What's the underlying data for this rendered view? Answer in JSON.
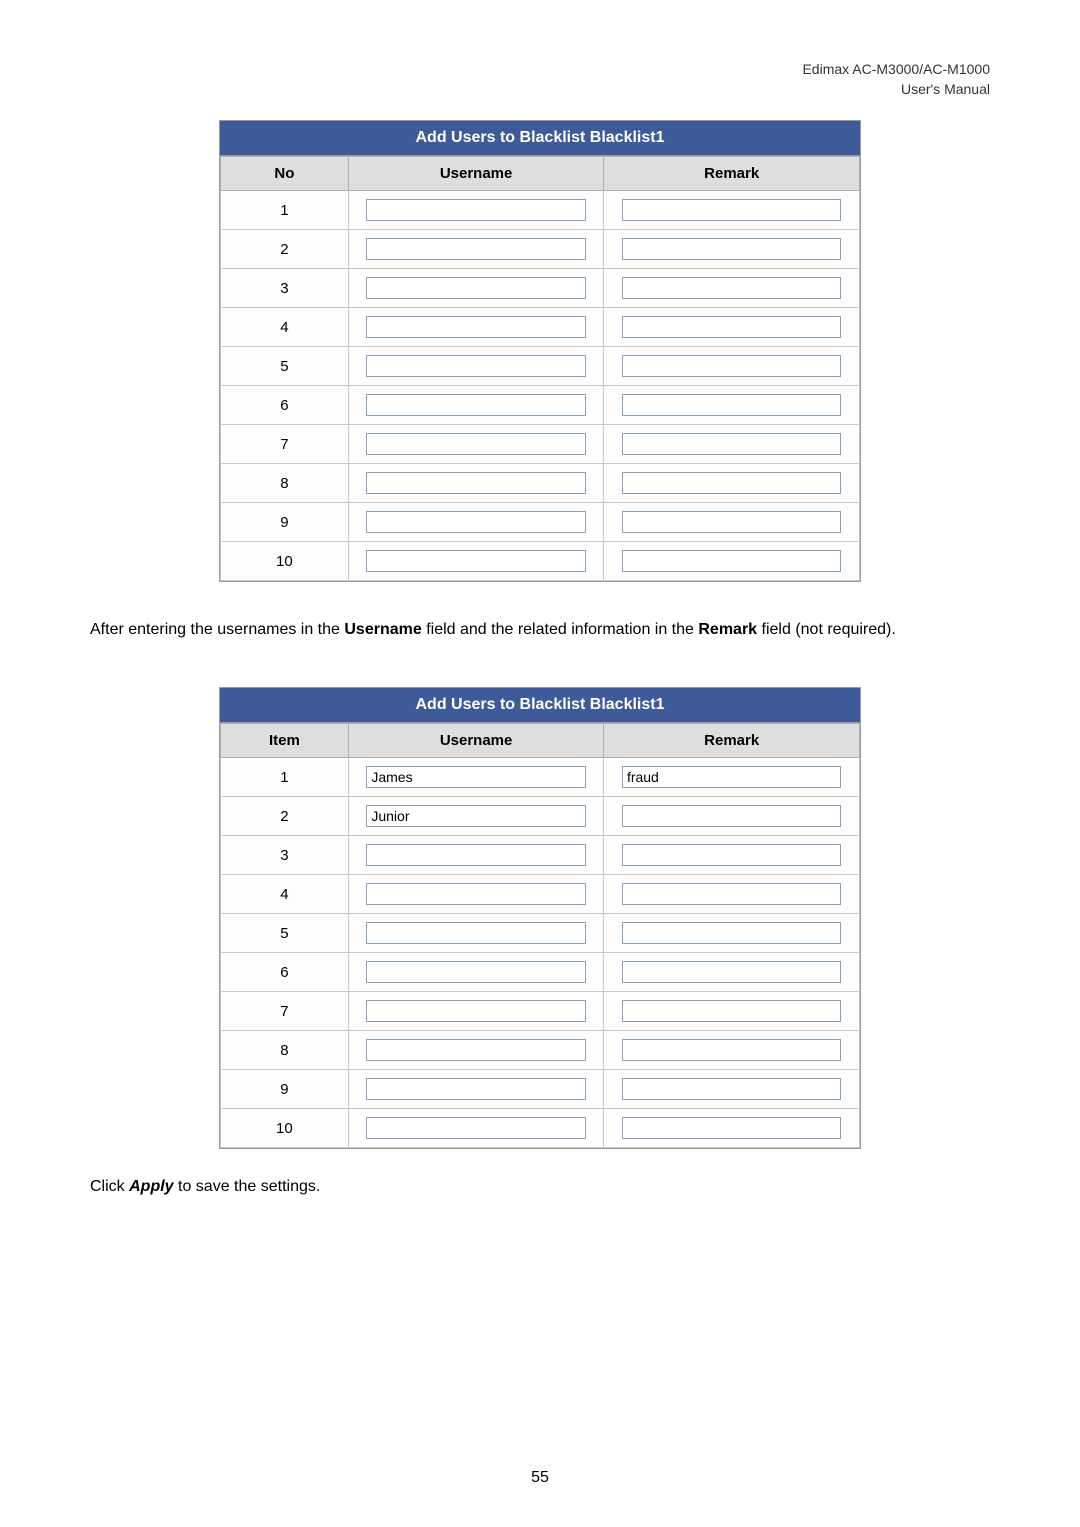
{
  "header": {
    "product": "Edimax  AC-M3000/AC-M1000",
    "doc": "User's  Manual"
  },
  "table1": {
    "title": "Add Users to Blacklist Blacklist1",
    "col_no": "No",
    "col_user": "Username",
    "col_remark": "Remark",
    "rows": [
      {
        "no": "1",
        "user": "",
        "remark": ""
      },
      {
        "no": "2",
        "user": "",
        "remark": ""
      },
      {
        "no": "3",
        "user": "",
        "remark": ""
      },
      {
        "no": "4",
        "user": "",
        "remark": ""
      },
      {
        "no": "5",
        "user": "",
        "remark": ""
      },
      {
        "no": "6",
        "user": "",
        "remark": ""
      },
      {
        "no": "7",
        "user": "",
        "remark": ""
      },
      {
        "no": "8",
        "user": "",
        "remark": ""
      },
      {
        "no": "9",
        "user": "",
        "remark": ""
      },
      {
        "no": "10",
        "user": "",
        "remark": ""
      }
    ]
  },
  "paragraph": {
    "p1a": "After entering the usernames in the ",
    "p1b": "Username",
    "p1c": " field and the related information in the ",
    "p1d": "Remark",
    "p1e": " field (not required)."
  },
  "table2": {
    "title": "Add Users to Blacklist Blacklist1",
    "col_item": "Item",
    "col_user": "Username",
    "col_remark": "Remark",
    "rows": [
      {
        "no": "1",
        "user": "James",
        "remark": "fraud"
      },
      {
        "no": "2",
        "user": "Junior",
        "remark": ""
      },
      {
        "no": "3",
        "user": "",
        "remark": ""
      },
      {
        "no": "4",
        "user": "",
        "remark": ""
      },
      {
        "no": "5",
        "user": "",
        "remark": ""
      },
      {
        "no": "6",
        "user": "",
        "remark": ""
      },
      {
        "no": "7",
        "user": "",
        "remark": ""
      },
      {
        "no": "8",
        "user": "",
        "remark": ""
      },
      {
        "no": "9",
        "user": "",
        "remark": ""
      },
      {
        "no": "10",
        "user": "",
        "remark": ""
      }
    ]
  },
  "closing": {
    "a": "Click ",
    "b": "Apply",
    "c": " to save the settings."
  },
  "page_number": "55"
}
